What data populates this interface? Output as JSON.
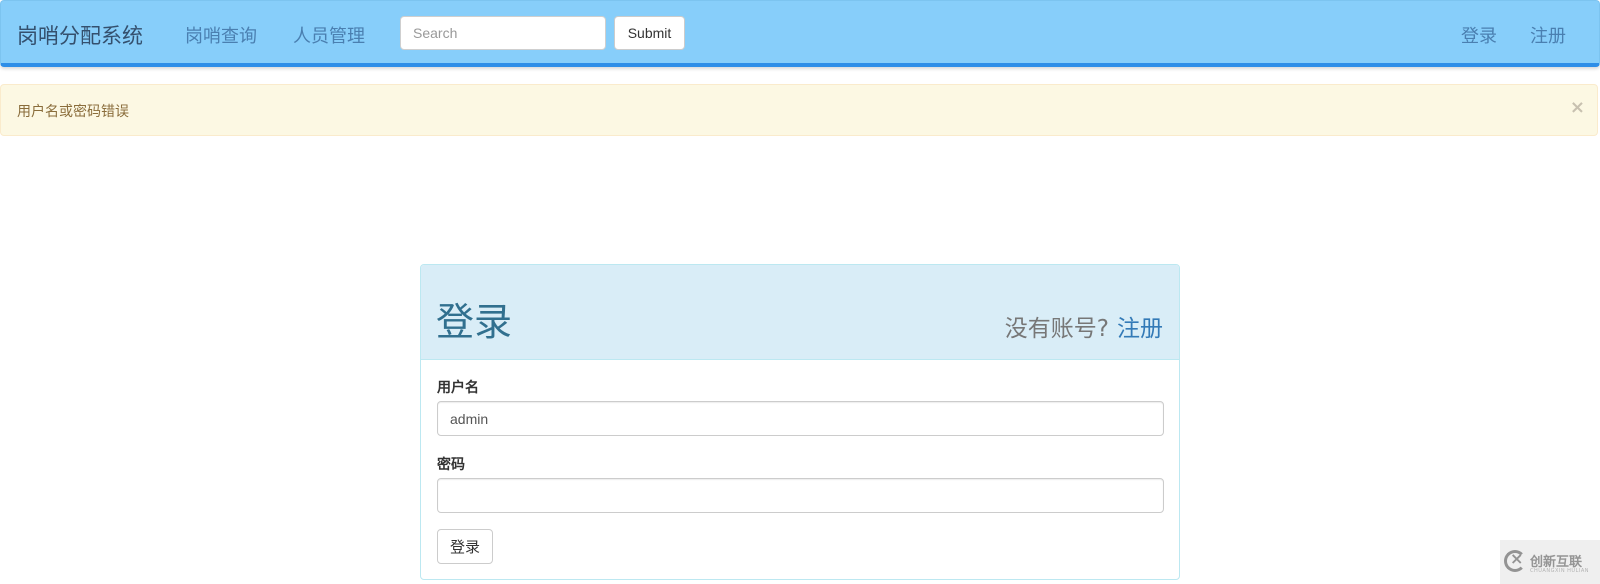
{
  "navbar": {
    "brand": "岗哨分配系统",
    "links": [
      {
        "label": "岗哨查询"
      },
      {
        "label": "人员管理"
      }
    ],
    "search": {
      "placeholder": "Search",
      "value": ""
    },
    "submit_label": "Submit",
    "right_links": [
      {
        "label": "登录"
      },
      {
        "label": "注册"
      }
    ]
  },
  "alert": {
    "message": "用户名或密码错误",
    "close_icon": "×",
    "type": "warning"
  },
  "login_panel": {
    "title": "登录",
    "no_account_text": "没有账号?",
    "register_link": "注册",
    "fields": [
      {
        "label": "用户名",
        "value": "admin",
        "type": "text"
      },
      {
        "label": "密码",
        "value": "",
        "type": "password"
      }
    ],
    "submit_label": "登录"
  },
  "watermark": {
    "text": "创新互联",
    "subtext": "CHUANGXIN HULIAN"
  },
  "colors": {
    "navbar_bg": "#87cefa",
    "navbar_border": "#2e8ee8",
    "alert_bg": "#fcf8e3",
    "alert_text": "#8a6d3b",
    "panel_heading_bg": "#d9edf7",
    "panel_title": "#31708f",
    "link": "#337ab7"
  }
}
